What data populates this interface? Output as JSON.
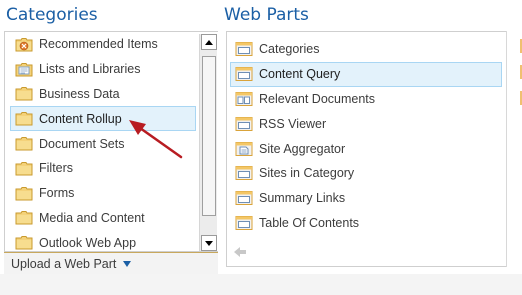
{
  "categories": {
    "heading": "Categories",
    "items": [
      {
        "label": "Recommended Items",
        "icon": "recommended-folder-icon",
        "selected": false
      },
      {
        "label": "Lists and Libraries",
        "icon": "list-folder-icon",
        "selected": false
      },
      {
        "label": "Business Data",
        "icon": "folder-icon",
        "selected": false
      },
      {
        "label": "Content Rollup",
        "icon": "folder-icon",
        "selected": true
      },
      {
        "label": "Document Sets",
        "icon": "folder-icon",
        "selected": false
      },
      {
        "label": "Filters",
        "icon": "folder-icon",
        "selected": false
      },
      {
        "label": "Forms",
        "icon": "folder-icon",
        "selected": false
      },
      {
        "label": "Media and Content",
        "icon": "folder-icon",
        "selected": false
      },
      {
        "label": "Outlook Web App",
        "icon": "folder-icon",
        "selected": false
      }
    ],
    "upload_label": "Upload a Web Part"
  },
  "web_parts": {
    "heading": "Web Parts",
    "items": [
      {
        "label": "Categories",
        "icon": "web-part-icon",
        "selected": false
      },
      {
        "label": "Content Query",
        "icon": "web-part-icon",
        "selected": true
      },
      {
        "label": "Relevant Documents",
        "icon": "relevant-documents-icon",
        "selected": false
      },
      {
        "label": "RSS Viewer",
        "icon": "web-part-icon",
        "selected": false
      },
      {
        "label": "Site Aggregator",
        "icon": "document-icon",
        "selected": false
      },
      {
        "label": "Sites in Category",
        "icon": "web-part-icon",
        "selected": false
      },
      {
        "label": "Summary Links",
        "icon": "web-part-icon",
        "selected": false
      },
      {
        "label": "Table Of Contents",
        "icon": "web-part-icon",
        "selected": false
      }
    ]
  },
  "colors": {
    "heading": "#1b5fa5",
    "selection_bg": "#e3f2fb",
    "selection_border": "#a9d6f3",
    "annotation_arrow": "#b81c22"
  }
}
